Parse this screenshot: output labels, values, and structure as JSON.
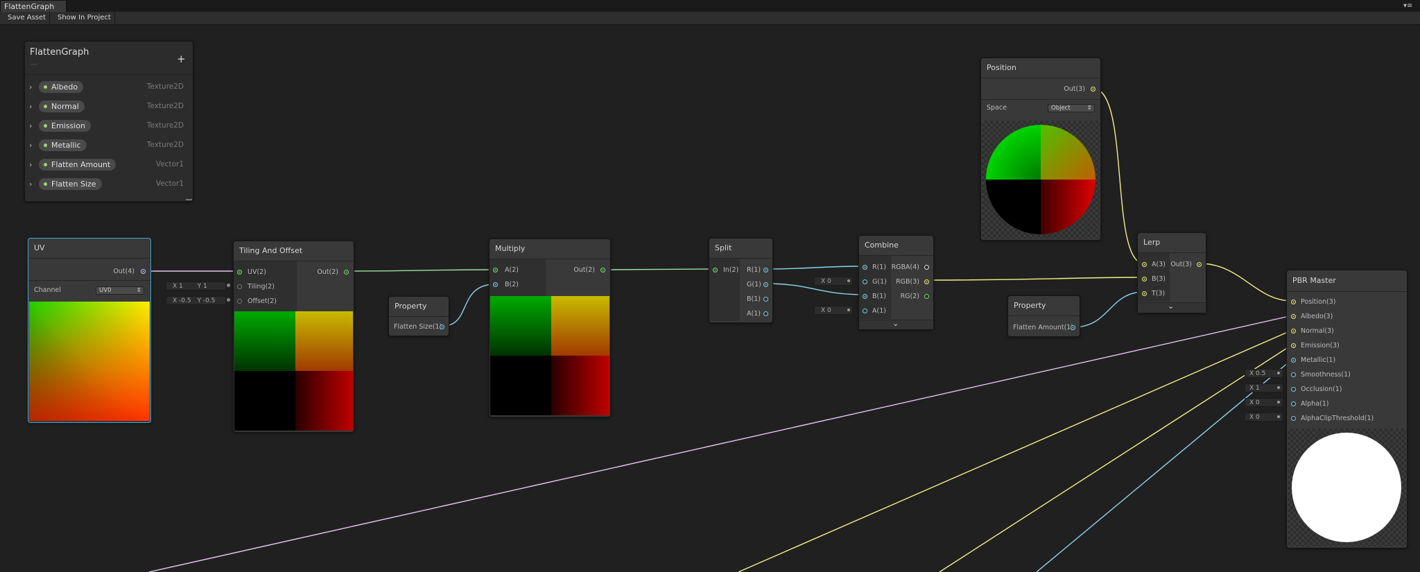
{
  "window": {
    "tab_title": "FlattenGraph"
  },
  "toolbar": {
    "save_label": "Save Asset",
    "show_label": "Show In Project"
  },
  "blackboard": {
    "title": "FlattenGraph",
    "subtitle": "---",
    "add_label": "+",
    "properties": [
      {
        "name": "Albedo",
        "type": "Texture2D"
      },
      {
        "name": "Normal",
        "type": "Texture2D"
      },
      {
        "name": "Emission",
        "type": "Texture2D"
      },
      {
        "name": "Metallic",
        "type": "Texture2D"
      },
      {
        "name": "Flatten Amount",
        "type": "Vector1"
      },
      {
        "name": "Flatten Size",
        "type": "Vector1"
      }
    ]
  },
  "nodes": {
    "uv": {
      "title": "UV",
      "out": "Out(4)",
      "channel_label": "Channel",
      "channel_value": "UV0"
    },
    "tiling": {
      "title": "Tiling And Offset",
      "in1": "UV(2)",
      "in2": "Tiling(2)",
      "in3": "Offset(2)",
      "out": "Out(2)",
      "tiling_x": "X 1",
      "tiling_y": "Y 1",
      "offset_x": "X -0.5",
      "offset_y": "Y -0.5"
    },
    "prop_size": {
      "title": "Property",
      "out": "Flatten Size(1)"
    },
    "multiply": {
      "title": "Multiply",
      "in1": "A(2)",
      "in2": "B(2)",
      "out": "Out(2)"
    },
    "split": {
      "title": "Split",
      "in": "In(2)",
      "o1": "R(1)",
      "o2": "G(1)",
      "o3": "B(1)",
      "o4": "A(1)"
    },
    "combine": {
      "title": "Combine",
      "i1": "R(1)",
      "i2": "G(1)",
      "i3": "B(1)",
      "i4": "A(1)",
      "o1": "RGBA(4)",
      "o2": "RGB(3)",
      "o3": "RG(2)",
      "g_default": "X 0",
      "a_default": "X 0"
    },
    "position": {
      "title": "Position",
      "out": "Out(3)",
      "space_label": "Space",
      "space_value": "Object"
    },
    "lerp": {
      "title": "Lerp",
      "i1": "A(3)",
      "i2": "B(3)",
      "i3": "T(3)",
      "out": "Out(3)"
    },
    "prop_amount": {
      "title": "Property",
      "out": "Flatten Amount(1)"
    },
    "pbr": {
      "title": "PBR Master",
      "inputs": [
        "Position(3)",
        "Albedo(3)",
        "Normal(3)",
        "Emission(3)",
        "Metallic(1)",
        "Smoothness(1)",
        "Occlusion(1)",
        "Alpha(1)",
        "AlphaClipThreshold(1)"
      ],
      "smoothness": "X 0.5",
      "occlusion": "X 1",
      "alpha": "X 0",
      "clip": "X 0"
    }
  },
  "colors": {
    "bg": "#202020",
    "node": "#393939",
    "selected": "#44a8d8",
    "wire_vec2": "#9be39b",
    "wire_vec3": "#f2f28a",
    "wire_vec1": "#8ad7ec",
    "wire_vec4": "#e8c8f0"
  }
}
